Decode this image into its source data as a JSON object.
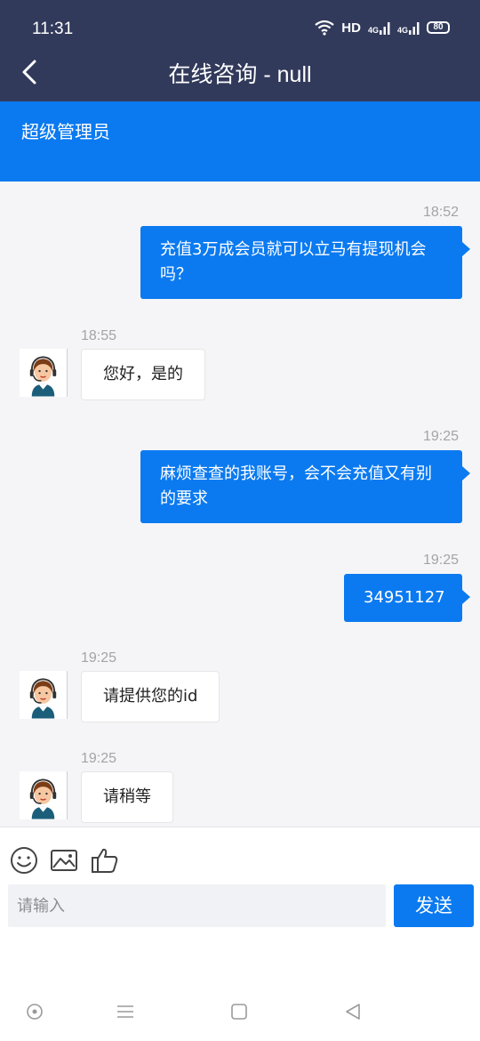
{
  "status_bar": {
    "time": "11:31",
    "hd_label": "HD",
    "net1": "4G",
    "net2": "4G",
    "battery": "80"
  },
  "nav": {
    "title": "在线咨询 - null"
  },
  "banner": {
    "text": "超级管理员"
  },
  "messages": [
    {
      "from": "me",
      "time": "18:52",
      "text": "充值3万成会员就可以立马有提现机会吗？"
    },
    {
      "from": "agent",
      "time": "18:55",
      "text": "您好，是的"
    },
    {
      "from": "me",
      "time": "19:25",
      "text": "麻烦查查的我账号，会不会充值又有别的要求"
    },
    {
      "from": "me",
      "time": "19:25",
      "text": "34951127"
    },
    {
      "from": "agent",
      "time": "19:25",
      "text": "请提供您的id"
    },
    {
      "from": "agent",
      "time": "19:25",
      "text": "请稍等"
    }
  ],
  "toolbar": {
    "icons": [
      "emoji-icon",
      "image-icon",
      "thumbs-up-icon"
    ],
    "input_placeholder": "请输入",
    "input_value": "",
    "send_label": "发送"
  },
  "colors": {
    "header": "#323a5b",
    "accent": "#0b7af0",
    "chat_bg": "#f5f5f7"
  }
}
